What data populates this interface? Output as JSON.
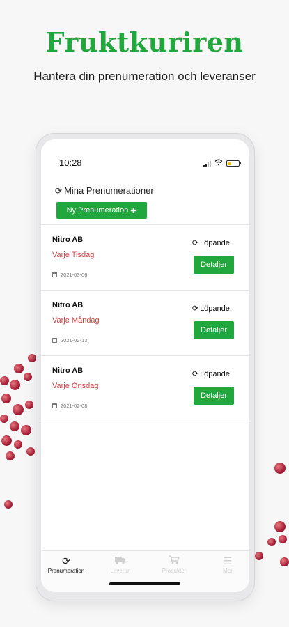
{
  "brand": {
    "name": "Fruktkuriren",
    "tagline": "Hantera din prenumeration och leveranser",
    "color": "#22a73f"
  },
  "status_bar": {
    "time": "10:28"
  },
  "page": {
    "title": "Mina Prenumerationer",
    "title_icon": "sync-icon",
    "new_button_label": "Ny Prenumeration",
    "new_button_icon": "plus-icon"
  },
  "subscriptions": [
    {
      "company": "Nitro AB",
      "day": "Varje Tisdag",
      "date": "2021-03-06",
      "status": "Löpande..",
      "button": "Detaljer"
    },
    {
      "company": "Nitro AB",
      "day": "Varje Måndag",
      "date": "2021-02-13",
      "status": "Löpande..",
      "button": "Detaljer"
    },
    {
      "company": "Nitro AB",
      "day": "Varje Onsdag",
      "date": "2021-02-08",
      "status": "Löpande..",
      "button": "Detaljer"
    }
  ],
  "tabbar": [
    {
      "label": "Prenumeration",
      "icon": "sync-icon",
      "active": true
    },
    {
      "label": "Leveran",
      "icon": "truck-icon",
      "active": false
    },
    {
      "label": "Produkter",
      "icon": "cart-icon",
      "active": false
    },
    {
      "label": "Mer",
      "icon": "menu-icon",
      "active": false
    }
  ],
  "colors": {
    "accent": "#22a73f",
    "day_text": "#d24545",
    "inactive_tab": "#cfcfcf"
  }
}
